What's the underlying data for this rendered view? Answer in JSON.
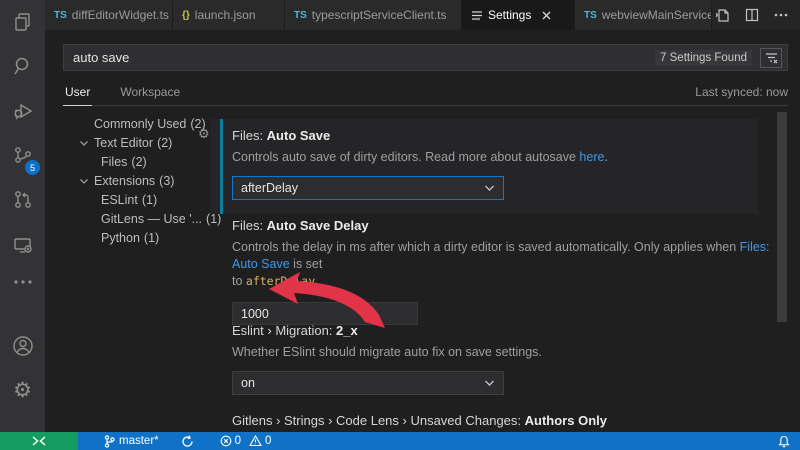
{
  "colors": {
    "accent_blue": "#0d77d1",
    "status_bar_blue": "#0f72c6",
    "remote_green": "#149c60",
    "modified_indicator_teal": "#0c7d9d",
    "link_blue": "#4098e8",
    "code_gold": "#d9b368",
    "annotation_arrow_red": "#e23448",
    "scm_badge_blue": "#0e70c8",
    "ts_icon_cyan": "#4fb6d8",
    "json_icon_yellow": "#c7c944"
  },
  "activity_bar": {
    "scm_badge": "5"
  },
  "tab_bar": {
    "tabs": [
      {
        "label": "diffEditorWidget.ts",
        "icon_text": "TS"
      },
      {
        "label": "launch.json",
        "icon_text": "{}"
      },
      {
        "label": "typescriptServiceClient.ts",
        "icon_text": "TS"
      },
      {
        "label": "Settings"
      },
      {
        "label": "webviewMainService.t",
        "icon_text": "TS"
      }
    ]
  },
  "search": {
    "value": "auto save",
    "results_count": "7 Settings Found"
  },
  "scope": {
    "tabs": [
      {
        "label": "User"
      },
      {
        "label": "Workspace"
      }
    ],
    "last_synced": "Last synced: now"
  },
  "toc": {
    "items": [
      {
        "label": "Commonly Used",
        "count": "(2)"
      },
      {
        "label": "Text Editor",
        "count": "(2)"
      },
      {
        "label": "Files",
        "count": "(2)"
      },
      {
        "label": "Extensions",
        "count": "(3)"
      },
      {
        "label": "ESLint",
        "count": "(1)"
      },
      {
        "label": "GitLens — Use '...",
        "count": "(1)"
      },
      {
        "label": "Python",
        "count": "(1)"
      }
    ]
  },
  "settings": {
    "auto_save": {
      "title_prefix": "Files: ",
      "title_name": "Auto Save",
      "desc_before": "Controls auto save of dirty editors. Read more about autosave ",
      "desc_link": "here",
      "desc_after": ".",
      "value": "afterDelay"
    },
    "auto_save_delay": {
      "title_prefix": "Files: ",
      "title_name": "Auto Save Delay",
      "desc_line1_before": "Controls the delay in ms after which a dirty editor is saved automatically. Only applies when ",
      "desc_line1_link": "Files: Auto Save",
      "desc_line1_after": " is set",
      "desc_line2_before": "to ",
      "desc_line2_code": "afterDelay",
      "desc_line2_after": ".",
      "value": "1000"
    },
    "eslint_migration": {
      "title_prefix": "Eslint › Migration: ",
      "title_name": "2_x",
      "desc": "Whether ESlint should migrate auto fix on save settings.",
      "value": "on"
    },
    "gitlens_codelens": {
      "title_prefix": "Gitlens › Strings › Code Lens › Unsaved Changes: ",
      "title_name": "Authors Only"
    }
  },
  "status_bar": {
    "branch": "master*",
    "errors": "0",
    "warnings": "0"
  }
}
